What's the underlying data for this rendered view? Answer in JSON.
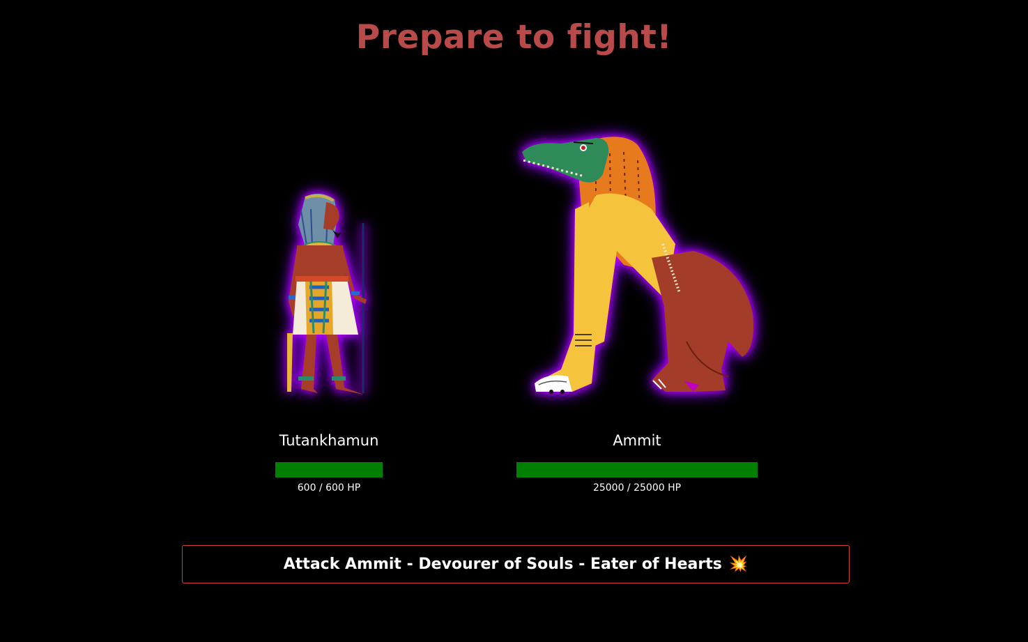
{
  "title": "Prepare to fight!",
  "player": {
    "name": "Tutankhamun",
    "hp_current": 600,
    "hp_max": 600,
    "hp_text": "600 / 600 HP",
    "hp_fraction": 1.0
  },
  "enemy": {
    "name": "Ammit",
    "hp_current": 25000,
    "hp_max": 25000,
    "hp_text": "25000 / 25000 HP",
    "hp_fraction": 1.0
  },
  "attack_button": {
    "label": "Attack Ammit - Devourer of Souls - Eater of Hearts",
    "icon": "💥",
    "icon_name": "collision-icon"
  },
  "colors": {
    "title": "#b84a4a",
    "hp_fill": "#008000",
    "button_border": "#d23c3c",
    "glow": "#c000ff"
  }
}
